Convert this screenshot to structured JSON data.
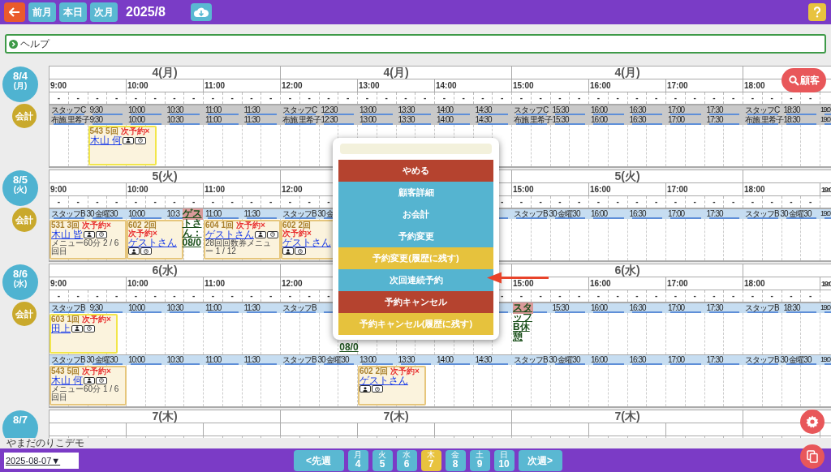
{
  "top_bar": {
    "buttons": [
      "前月",
      "本日",
      "次月"
    ],
    "title": "2025/8"
  },
  "help": {
    "label": "ヘルプ"
  },
  "customer_button": {
    "label": "顧客"
  },
  "days": [
    {
      "date": "8/4",
      "weekday": "(月)",
      "checkout": "会計",
      "headers": [
        "4(月)",
        "4(月)",
        "4(月)"
      ],
      "hours": [
        "9:00",
        "10:00",
        "11:00",
        "12:00",
        "13:00",
        "14:00",
        "15:00",
        "16:00",
        "17:00",
        "18:00"
      ],
      "dashes": [
        "-",
        "-",
        "-",
        "-",
        "-",
        "-",
        "-",
        "-",
        "-",
        "-",
        "-",
        "-",
        "-",
        "-",
        "-",
        "-",
        "-",
        "-",
        "-",
        "-",
        "-",
        "-",
        "-",
        "-",
        "-",
        "-",
        "-",
        "-",
        "-",
        "-",
        "-",
        "-",
        "-",
        "-",
        "-",
        "-",
        "-",
        "-",
        "-",
        "-"
      ],
      "lanes": [
        {
          "color": "#c9c9c9",
          "slots": [
            {
              "kind": "single",
              "label": "スタッフC"
            },
            {
              "kind": "single",
              "label": "9:30"
            },
            {
              "kind": "single",
              "label": "10:00"
            },
            {
              "kind": "single",
              "label": "10:30"
            },
            {
              "kind": "single",
              "label": "11:00"
            },
            {
              "kind": "single",
              "label": "11:30"
            },
            {
              "kind": "single",
              "label": "スタッフC"
            },
            {
              "kind": "single",
              "label": "12:30"
            },
            {
              "kind": "single",
              "label": "13:00"
            },
            {
              "kind": "single",
              "label": "13:30"
            },
            {
              "kind": "single",
              "label": "14:00"
            },
            {
              "kind": "single",
              "label": "14:30"
            },
            {
              "kind": "single",
              "label": "スタッフC"
            },
            {
              "kind": "single",
              "label": "15:30"
            },
            {
              "kind": "single",
              "label": "16:00"
            },
            {
              "kind": "single",
              "label": "16:30"
            },
            {
              "kind": "single",
              "label": "17:00"
            },
            {
              "kind": "single",
              "label": "17:30"
            },
            {
              "kind": "single",
              "label": "スタッフC"
            },
            {
              "kind": "single",
              "label": "18:30"
            },
            {
              "kind": "single",
              "label": "19:0"
            }
          ]
        },
        {
          "color": "#c9c9c9",
          "slots": [
            {
              "kind": "single",
              "label": "布施 里希子"
            },
            {
              "kind": "single",
              "label": "9:30",
              "appointments": [
                {
                  "kind": "short",
                  "color": "#f2e64a",
                  "number": "543 5回",
                  "next": "次予約×",
                  "name": "木山 何"
                }
              ]
            },
            {
              "kind": "single",
              "label": "10:00"
            },
            {
              "kind": "single",
              "label": "10:30"
            },
            {
              "kind": "single",
              "label": "11:00"
            },
            {
              "kind": "single",
              "label": "11:30"
            },
            {
              "kind": "single",
              "label": "布施 里希子"
            },
            {
              "kind": "single",
              "label": "12:30"
            },
            {
              "kind": "single",
              "label": "13:00"
            },
            {
              "kind": "single",
              "label": "13:30"
            },
            {
              "kind": "single",
              "label": "14:00"
            },
            {
              "kind": "single",
              "label": "14:30"
            },
            {
              "kind": "single",
              "label": "布施 里希子"
            },
            {
              "kind": "single",
              "label": "15:30"
            },
            {
              "kind": "single",
              "label": "16:00"
            },
            {
              "kind": "single",
              "label": "16:30"
            },
            {
              "kind": "single",
              "label": "17:00"
            },
            {
              "kind": "single",
              "label": "17:30"
            },
            {
              "kind": "single",
              "label": "布施 里希子"
            },
            {
              "kind": "single",
              "label": "18:30"
            },
            {
              "kind": "single",
              "label": "19:0"
            }
          ]
        }
      ]
    },
    {
      "date": "8/5",
      "weekday": "(火)",
      "checkout": "会計",
      "headers": [
        "5(火)"
      ],
      "headers_right": [
        "5(火)"
      ],
      "hours": [
        "9:00",
        "10:00",
        "11:00",
        "12:00"
      ],
      "hours_right": [
        "15:00",
        "16:00",
        "17:00",
        "18:00",
        "19:0"
      ],
      "dashes": [
        "-",
        "-",
        "-",
        "-",
        "-",
        "-",
        "-",
        "-",
        "-",
        "-",
        "-",
        "-",
        "-",
        "-",
        "-"
      ],
      "dashes_right": [
        "-",
        "-",
        "-",
        "-",
        "-",
        "-",
        "-",
        "-",
        "-",
        "-",
        "-",
        "-",
        "-",
        "-",
        "-",
        "-",
        "-"
      ],
      "lanes": [
        {
          "color": "#c6ddf1",
          "slots": [
            {
              "kind": "double",
              "label": "スタッフB 30 金曜30",
              "appointments": [
                {
                  "kind": "wide",
                  "color": "#e6c67c",
                  "number": "531 3回",
                  "next": "次予約×",
                  "name": "木山 皆",
                  "menu": "メニュー60分 2 / 6回目"
                }
              ]
            },
            {
              "kind": "single",
              "label": "10:00",
              "appointments": [
                {
                  "kind": "narrow",
                  "color": "#e6c67c",
                  "number": "602 2回",
                  "next": "次予約×",
                  "name": "ゲストさん"
                }
              ]
            },
            {
              "kind": "single",
              "label": "10:3",
              "appointments": [
                {
                  "kind": "note",
                  "color": "#d99a9a",
                  "text": "ゲストさん：08/0"
                }
              ]
            },
            {
              "kind": "single",
              "label": "11:00",
              "appointments": [
                {
                  "kind": "wide",
                  "color": "#e6c67c",
                  "number": "604 1回",
                  "next": "次予約×",
                  "name": "ゲストさん",
                  "menu": "28回回数券メニュー 1 / 12"
                }
              ]
            },
            {
              "kind": "single",
              "label": "11:30"
            },
            {
              "kind": "single",
              "label": "スタッフB 30 金",
              "appointments": [
                {
                  "kind": "narrow",
                  "color": "#e6c67c",
                  "number": "602 2回",
                  "next": "次予約×",
                  "name": "ゲストさん"
                }
              ]
            }
          ],
          "slots_right": [
            {
              "kind": "double",
              "label": "スタッフB 30 金曜30"
            },
            {
              "kind": "single",
              "label": "16:00"
            },
            {
              "kind": "single",
              "label": "16:30"
            },
            {
              "kind": "single",
              "label": "17:00"
            },
            {
              "kind": "single",
              "label": "17:30"
            },
            {
              "kind": "double",
              "label": "スタッフB 30 金曜30"
            },
            {
              "kind": "single",
              "label": "19:0"
            }
          ]
        }
      ]
    },
    {
      "date": "8/6",
      "weekday": "(水)",
      "checkout": "会計",
      "headers": [
        "6(水)"
      ],
      "headers_right": [
        "6(水)"
      ],
      "hours": [
        "9:00",
        "10:00",
        "11:00",
        "12:00"
      ],
      "hours_right": [
        "15:00",
        "16:00",
        "17:00",
        "18:00",
        "19:0"
      ],
      "dashes": [
        "-",
        "-",
        "-",
        "-",
        "-",
        "-",
        "-",
        "-",
        "-",
        "-",
        "-",
        "-",
        "-",
        "-",
        "-"
      ],
      "dashes_right": [
        "-",
        "-",
        "-",
        "-",
        "-",
        "-",
        "-",
        "-",
        "-",
        "-",
        "-",
        "-",
        "-",
        "-",
        "-",
        "-",
        "-"
      ],
      "lanes": [
        {
          "color": "#c6ddf1",
          "slots": [
            {
              "kind": "single",
              "label": "スタッフB",
              "appointments": [
                {
                  "kind": "short",
                  "color": "#f2e64a",
                  "number": "603 1回",
                  "next": "次予約×",
                  "name": "田上"
                }
              ]
            },
            {
              "kind": "single",
              "label": "9:30"
            },
            {
              "kind": "single",
              "label": "10:00"
            },
            {
              "kind": "single",
              "label": "10:30"
            },
            {
              "kind": "single",
              "label": "11:00"
            },
            {
              "kind": "single",
              "label": "11:30"
            },
            {
              "kind": "single",
              "label": "スタッフB"
            },
            {
              "kind": "single",
              "appointments": [
                {
                  "kind": "tail",
                  "text": "08/0"
                }
              ]
            }
          ],
          "slots_right": [
            {
              "kind": "single",
              "appointments": [
                {
                  "kind": "break",
                  "color": "#d99a9a",
                  "text": "スタッフB休憩"
                }
              ]
            },
            {
              "kind": "single",
              "label": "15:30"
            },
            {
              "kind": "single",
              "label": "16:00"
            },
            {
              "kind": "single",
              "label": "16:30"
            },
            {
              "kind": "single",
              "label": "17:00"
            },
            {
              "kind": "single",
              "label": "17:30"
            },
            {
              "kind": "single",
              "label": "スタッフB"
            },
            {
              "kind": "single",
              "label": "18:30"
            },
            {
              "kind": "single",
              "label": "19:0"
            }
          ]
        },
        {
          "color": "#c6ddf1",
          "slots": [
            {
              "kind": "double",
              "label": "スタッフB 30 金曜30",
              "appointments": [
                {
                  "kind": "wide",
                  "color": "#e6c67c",
                  "number": "543 5回",
                  "next": "次予約×",
                  "name": "木山 何",
                  "menu": "メニュー60分 1 / 6回目"
                }
              ]
            },
            {
              "kind": "single",
              "label": "10:00"
            },
            {
              "kind": "single",
              "label": "10:30"
            },
            {
              "kind": "single",
              "label": "11:00"
            },
            {
              "kind": "single",
              "label": "11:30"
            },
            {
              "kind": "double",
              "label": "スタッフB 30 金曜30"
            },
            {
              "kind": "single",
              "label": "13:00",
              "appointments": [
                {
                  "kind": "short",
                  "color": "#e6c67c",
                  "number": "602 2回",
                  "next": "次予約×",
                  "name": "ゲストさん"
                }
              ]
            },
            {
              "kind": "single",
              "label": "13:30"
            },
            {
              "kind": "single",
              "label": "14:00"
            },
            {
              "kind": "single",
              "label": "14:30"
            },
            {
              "kind": "double",
              "label": "スタッフB 30 金曜30"
            },
            {
              "kind": "single",
              "label": "16:00"
            },
            {
              "kind": "single",
              "label": "16:30"
            },
            {
              "kind": "single",
              "label": "17:00"
            },
            {
              "kind": "single",
              "label": "17:30"
            },
            {
              "kind": "double",
              "label": "スタッフB 30 金曜30"
            },
            {
              "kind": "single",
              "label": "19:0"
            }
          ]
        }
      ]
    },
    {
      "date": "8/7",
      "headers": [
        "7(木)",
        "7(木)",
        "7(木)"
      ]
    }
  ],
  "popup": {
    "buttons": [
      {
        "label": "やめる",
        "kind": "cancel"
      },
      {
        "label": "顧客詳細",
        "kind": "info"
      },
      {
        "label": "お会計",
        "kind": "info"
      },
      {
        "label": "予約変更",
        "kind": "info"
      },
      {
        "label": "予約変更(履歴に残す)",
        "kind": "keep"
      },
      {
        "label": "次回連続予約",
        "kind": "info"
      },
      {
        "label": "予約キャンセル",
        "kind": "cancel"
      },
      {
        "label": "予約キャンセル(履歴に残す)",
        "kind": "keep"
      }
    ]
  },
  "footer_text": "やまだのりこデモ",
  "bottom_bar": {
    "date_select": "2025-08-07▼",
    "prev": "<先週",
    "next": "次週>",
    "days": [
      {
        "weekday": "月",
        "day": "4",
        "selected": false
      },
      {
        "weekday": "火",
        "day": "5",
        "selected": false
      },
      {
        "weekday": "水",
        "day": "6",
        "selected": false
      },
      {
        "weekday": "木",
        "day": "7",
        "selected": true
      },
      {
        "weekday": "金",
        "day": "8",
        "selected": false
      },
      {
        "weekday": "土",
        "day": "9",
        "selected": false
      },
      {
        "weekday": "日",
        "day": "10",
        "selected": false
      }
    ]
  }
}
